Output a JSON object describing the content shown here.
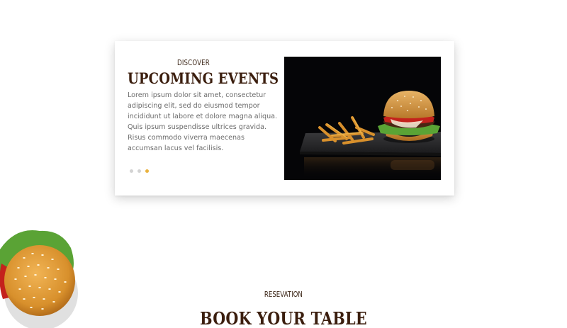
{
  "events": {
    "eyebrow": "DISCOVER",
    "title": "UPCOMING EVENTS",
    "body": "Lorem ipsum dolor sit amet, consectetur adipiscing elit, sed do eiusmod tempor incididunt ut labore et dolore magna aliqua. Quis ipsum suspendisse ultrices gravida. Risus commodo viverra maecenas accumsan lacus vel facilisis.",
    "image_icon": "burger-and-fries-photo",
    "slider": {
      "count": 3,
      "active_index": 2,
      "active_color": "#e9b23f",
      "inactive_color": "#d3d3d3"
    }
  },
  "decoration": {
    "icon": "burger-icon"
  },
  "reservation": {
    "eyebrow": "RESEVATION",
    "title": "BOOK YOUR TABLE"
  },
  "colors": {
    "heading": "#3b1e0e",
    "accent": "#e9b23f",
    "body_text": "#6b6b6b"
  }
}
